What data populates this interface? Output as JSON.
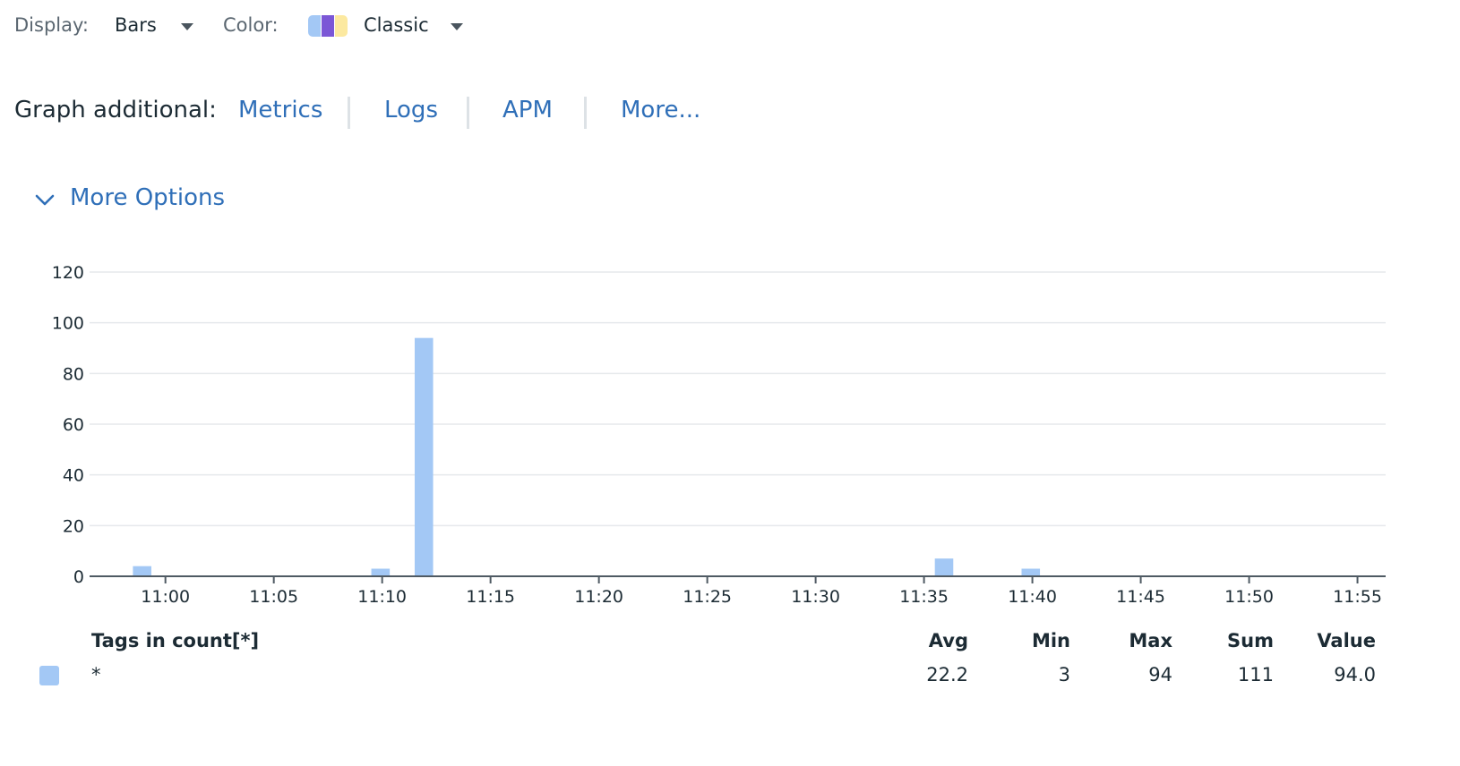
{
  "toolbar": {
    "display_label": "Display:",
    "display_value": "Bars",
    "color_label": "Color:",
    "color_value": "Classic",
    "palette_colors": [
      "#a3c8f5",
      "#7b57d6",
      "#fce9a0"
    ]
  },
  "graph_additional": {
    "label": "Graph additional:",
    "links": [
      "Metrics",
      "Logs",
      "APM",
      "More..."
    ]
  },
  "more_options": {
    "label": "More Options"
  },
  "chart_data": {
    "type": "bar",
    "y_ticks": [
      "0",
      "20",
      "40",
      "60",
      "80",
      "100",
      "120"
    ],
    "ylim": [
      0,
      120
    ],
    "x_ticks": [
      "11:00",
      "11:05",
      "11:10",
      "11:15",
      "11:20",
      "11:25",
      "11:30",
      "11:35",
      "11:40",
      "11:45",
      "11:50",
      "11:55"
    ],
    "xlim_minutes_after_11": [
      -3.5,
      56.3
    ],
    "bar_width_minutes": 0.85,
    "grid": true,
    "bar_color": "#a3c8f5",
    "points": [
      {
        "x": "10:58:30",
        "y": 4
      },
      {
        "x": "11:09:30",
        "y": 3
      },
      {
        "x": "11:11:30",
        "y": 94
      },
      {
        "x": "11:35:30",
        "y": 7
      },
      {
        "x": "11:39:30",
        "y": 3
      }
    ]
  },
  "legend": {
    "headers": {
      "tags": "Tags in count[*]",
      "avg": "Avg",
      "min": "Min",
      "max": "Max",
      "sum": "Sum",
      "value": "Value"
    },
    "rows": [
      {
        "tag": "*",
        "avg": "22.2",
        "min": "3",
        "max": "94",
        "sum": "111",
        "value": "94.0"
      }
    ]
  }
}
